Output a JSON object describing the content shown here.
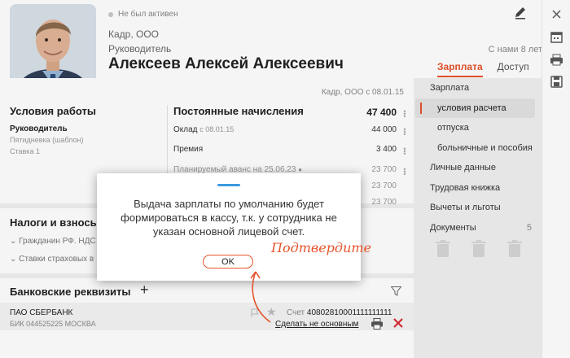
{
  "employee": {
    "status": "Не был активен",
    "company": "Кадр, ООО",
    "position": "Руководитель",
    "full_name": "Алексеев Алексей Алексеевич",
    "tenure": "С нами 8 лет",
    "company_since": "Кадр, ООО  с 08.01.15"
  },
  "tabs": [
    {
      "label": "Зарплата",
      "active": true
    },
    {
      "label": "Доступ",
      "active": false
    }
  ],
  "nav": {
    "salary": "Зарплата",
    "pay_terms": "условия расчета",
    "vacation": "отпуска",
    "sick": "больничные и пособия",
    "personal": "Личные данные",
    "workbook": "Трудовая книжка",
    "deductions": "Вычеты и льготы",
    "documents": "Документы",
    "documents_count": "5"
  },
  "conditions": {
    "title": "Условия работы",
    "position": "Руководитель",
    "schedule": "Пятидневка (шаблон)",
    "rate": "Ставка 1"
  },
  "accruals": {
    "title": "Постоянные начисления",
    "total": "47 400",
    "salary_label": "Оклад",
    "salary_date": "с 08.01.15",
    "salary_value": "44 000",
    "bonus_label": "Премия",
    "bonus_value": "3 400",
    "advance_label": "Планируемый аванс на 25.06.23",
    "advance_value": "23 700",
    "extra1_value": "23 700",
    "extra2_value": "23 700"
  },
  "taxes": {
    "title": "Налоги и взносы",
    "row1": "Гражданин РФ. НДС",
    "row2": "Ставки страховых в"
  },
  "bank": {
    "title": "Банковские реквизиты",
    "name": "ПАО СБЕРБАНК",
    "bik": "БИК  044525225 МОСКВА",
    "account_label": "Счет",
    "account": "40802810001111111111",
    "unset_link": "Сделать не основным"
  },
  "modal": {
    "message": "Выдача зарплаты по умолчанию будет формироваться в кассу, т.к. у сотрудника не указан основной лицевой счет.",
    "ok_label": "OK"
  },
  "annotation": {
    "text": "Подтвердите",
    "color": "#e5542b"
  },
  "colors": {
    "accent": "#e5542b",
    "link_blue": "#3b9adf"
  }
}
